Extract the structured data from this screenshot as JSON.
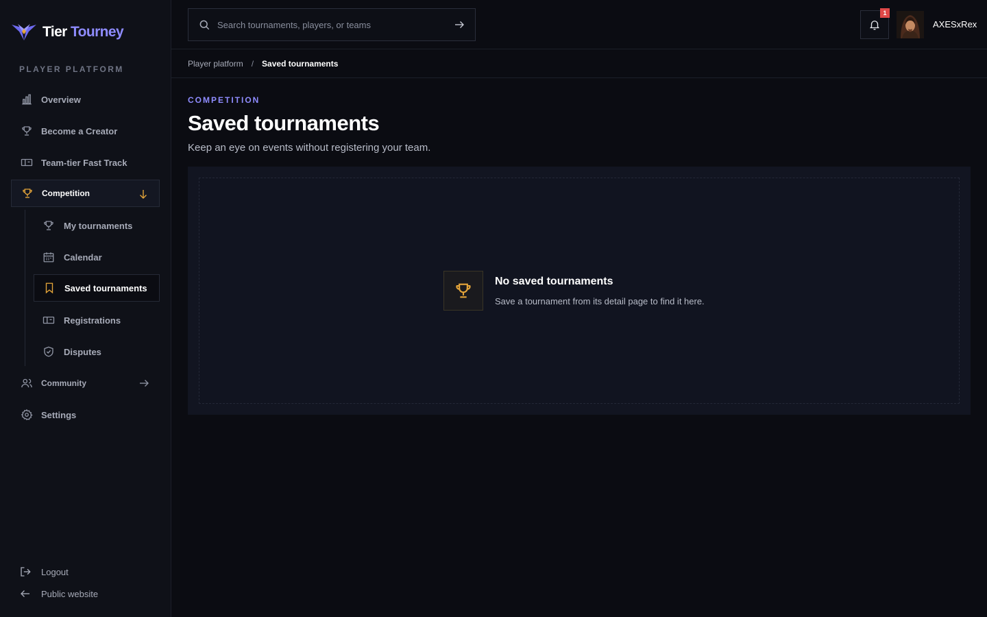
{
  "brand": {
    "name_part1": "Tier",
    "name_part2": "Tourney"
  },
  "sidebar": {
    "section_label": "PLAYER PLATFORM",
    "items": [
      {
        "label": "Overview",
        "icon": "bar-chart-icon"
      },
      {
        "label": "Become a Creator",
        "icon": "trophy-icon"
      },
      {
        "label": "Team-tier Fast Track",
        "icon": "ticket-icon"
      },
      {
        "label": "Competition",
        "icon": "trophy-icon",
        "state": "expanded"
      },
      {
        "label": "Community",
        "icon": "users-icon"
      },
      {
        "label": "Settings",
        "icon": "gear-icon"
      }
    ],
    "competition_sub": [
      {
        "label": "My tournaments",
        "icon": "trophy-icon"
      },
      {
        "label": "Calendar",
        "icon": "calendar-icon"
      },
      {
        "label": "Saved tournaments",
        "icon": "bookmark-icon",
        "active": true
      },
      {
        "label": "Registrations",
        "icon": "ticket-icon"
      },
      {
        "label": "Disputes",
        "icon": "shield-check-icon"
      }
    ],
    "footer": [
      {
        "label": "Logout",
        "icon": "logout-icon"
      },
      {
        "label": "Public website",
        "icon": "arrow-left-icon"
      }
    ]
  },
  "topbar": {
    "search_placeholder": "Search tournaments, players, or teams",
    "notification_count": "1",
    "username": "AXESxRex"
  },
  "breadcrumb": {
    "parent": "Player platform",
    "separator": "/",
    "current": "Saved tournaments"
  },
  "page": {
    "eyebrow": "COMPETITION",
    "title": "Saved tournaments",
    "subtitle": "Keep an eye on events without registering your team."
  },
  "empty_state": {
    "title": "No saved tournaments",
    "description": "Save a tournament from its detail page to find it here."
  },
  "colors": {
    "accent": "#8f8cff",
    "gold": "#e6a63a",
    "badge": "#e04848",
    "background": "#0b0c12"
  }
}
